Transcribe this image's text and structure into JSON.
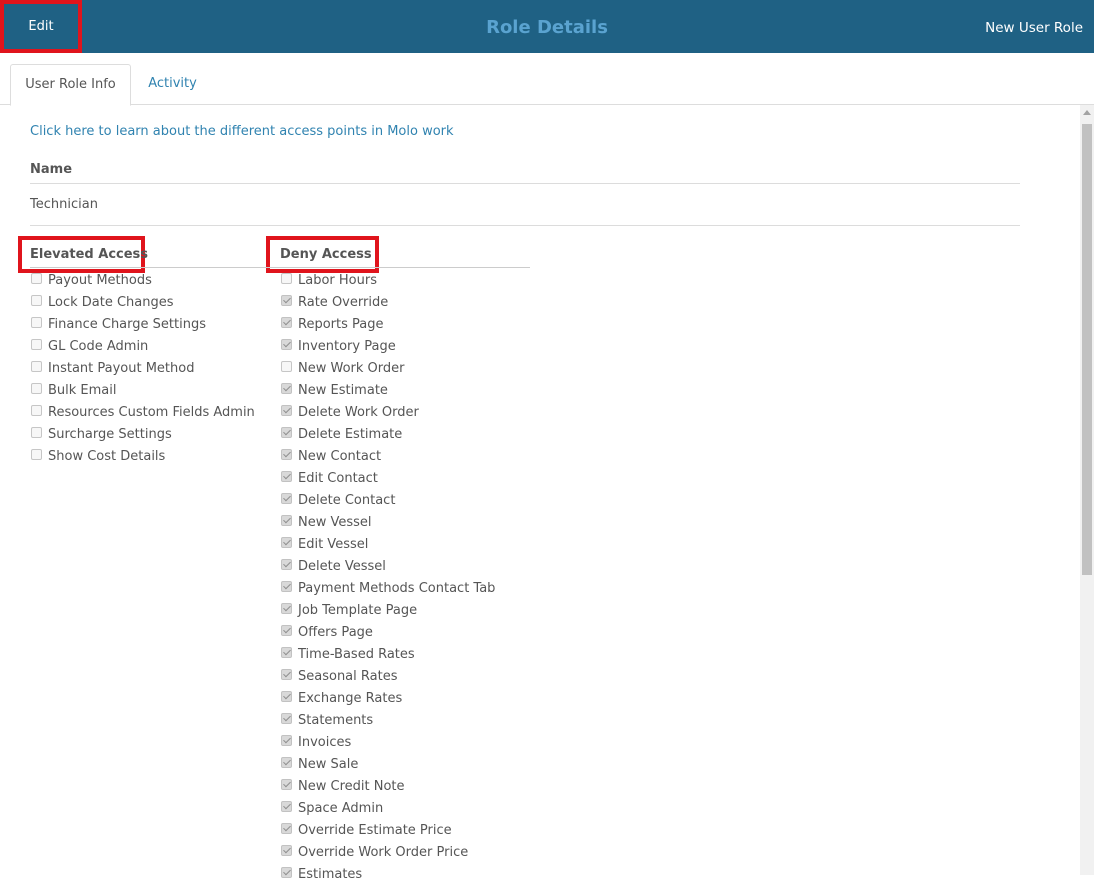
{
  "header": {
    "edit_label": "Edit",
    "title": "Role Details",
    "new_role_label": "New User Role"
  },
  "tabs": [
    {
      "label": "User Role Info",
      "active": true
    },
    {
      "label": "Activity",
      "active": false
    }
  ],
  "help_link": "Click here to learn about the different access points in Molo work",
  "name": {
    "label": "Name",
    "value": "Technician"
  },
  "elevated_access": {
    "title": "Elevated Access",
    "items": [
      {
        "label": "Payout Methods",
        "checked": false
      },
      {
        "label": "Lock Date Changes",
        "checked": false
      },
      {
        "label": "Finance Charge Settings",
        "checked": false
      },
      {
        "label": "GL Code Admin",
        "checked": false
      },
      {
        "label": "Instant Payout Method",
        "checked": false
      },
      {
        "label": "Bulk Email",
        "checked": false
      },
      {
        "label": "Resources Custom Fields Admin",
        "checked": false
      },
      {
        "label": "Surcharge Settings",
        "checked": false
      },
      {
        "label": "Show Cost Details",
        "checked": false
      }
    ]
  },
  "deny_access": {
    "title": "Deny Access",
    "items": [
      {
        "label": "Labor Hours",
        "checked": false
      },
      {
        "label": "Rate Override",
        "checked": true
      },
      {
        "label": "Reports Page",
        "checked": true
      },
      {
        "label": "Inventory Page",
        "checked": true
      },
      {
        "label": "New Work Order",
        "checked": false
      },
      {
        "label": "New Estimate",
        "checked": true
      },
      {
        "label": "Delete Work Order",
        "checked": true
      },
      {
        "label": "Delete Estimate",
        "checked": true
      },
      {
        "label": "New Contact",
        "checked": true
      },
      {
        "label": "Edit Contact",
        "checked": true
      },
      {
        "label": "Delete Contact",
        "checked": true
      },
      {
        "label": "New Vessel",
        "checked": true
      },
      {
        "label": "Edit Vessel",
        "checked": true
      },
      {
        "label": "Delete Vessel",
        "checked": true
      },
      {
        "label": "Payment Methods Contact Tab",
        "checked": true
      },
      {
        "label": "Job Template Page",
        "checked": true
      },
      {
        "label": "Offers Page",
        "checked": true
      },
      {
        "label": "Time-Based Rates",
        "checked": true
      },
      {
        "label": "Seasonal Rates",
        "checked": true
      },
      {
        "label": "Exchange Rates",
        "checked": true
      },
      {
        "label": "Statements",
        "checked": true
      },
      {
        "label": "Invoices",
        "checked": true
      },
      {
        "label": "New Sale",
        "checked": true
      },
      {
        "label": "New Credit Note",
        "checked": true
      },
      {
        "label": "Space Admin",
        "checked": true
      },
      {
        "label": "Override Estimate Price",
        "checked": true
      },
      {
        "label": "Override Work Order Price",
        "checked": true
      },
      {
        "label": "Estimates",
        "checked": true
      }
    ]
  },
  "colors": {
    "header_bg": "#1f6184",
    "title": "#5aa3d0",
    "link": "#3083b0",
    "highlight": "#e0141c"
  },
  "icons": [
    "scroll-up-arrow-icon"
  ]
}
